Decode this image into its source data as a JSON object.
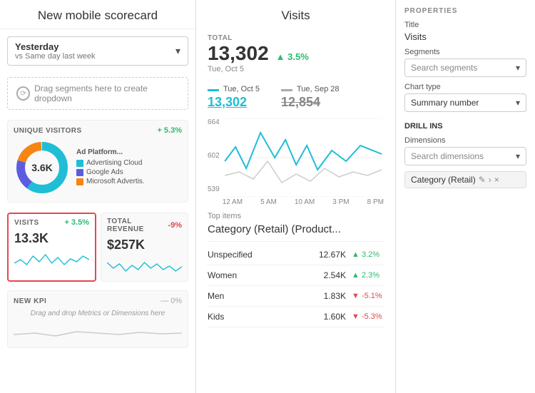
{
  "scorecard": {
    "title": "New mobile scorecard",
    "date_selector": {
      "main": "Yesterday",
      "sub": "vs Same day last week",
      "arrow": "▾"
    },
    "drag_segments": "Drag segments here to create dropdown",
    "unique_visitors": {
      "label": "UNIQUE VISITORS",
      "change": "+ 5.3%",
      "value": "3.6K",
      "legend_title": "Ad Platform...",
      "legend": [
        {
          "color": "#1fbed6",
          "label": "Advertising Cloud"
        },
        {
          "color": "#5c5ce0",
          "label": "Google Ads"
        },
        {
          "color": "#f68511",
          "label": "Microsoft Advertis."
        }
      ]
    },
    "visits_kpi": {
      "label": "VISITS",
      "change": "+ 3.5%",
      "value": "13.3K",
      "change_color": "pos"
    },
    "revenue_kpi": {
      "label": "TOTAL REVENUE",
      "change": "-9%",
      "value": "$257K",
      "change_color": "neg"
    },
    "new_kpi": {
      "label": "NEW KPI",
      "change": "— 0%",
      "desc": "Drag and drop Metrics or Dimensions here"
    }
  },
  "visits_panel": {
    "title": "Visits",
    "total_label": "TOTAL",
    "total_number": "13,302",
    "total_date": "Tue, Oct 5",
    "total_change": "▲ 3.5%",
    "comparison": [
      {
        "date": "Tue, Oct 5",
        "value": "13,302",
        "style": "teal"
      },
      {
        "date": "Tue, Sep 28",
        "value": "12,854",
        "style": "gray"
      }
    ],
    "chart_y_labels": [
      "664",
      "602",
      "539"
    ],
    "chart_x_labels": [
      "12 AM",
      "5 AM",
      "10 AM",
      "3 PM",
      "8 PM"
    ],
    "top_items_label": "Top items",
    "top_items_category": "Category (Retail) (Product...",
    "rows": [
      {
        "name": "Unspecified",
        "value": "12.67K",
        "change": "▲ 3.2%",
        "pos": true
      },
      {
        "name": "Women",
        "value": "2.54K",
        "change": "▲ 2.3%",
        "pos": true
      },
      {
        "name": "Men",
        "value": "1.83K",
        "change": "▼ -5.1%",
        "pos": false
      },
      {
        "name": "Kids",
        "value": "1.60K",
        "change": "▼ -5.3%",
        "pos": false
      }
    ]
  },
  "properties": {
    "section_title": "PROPERTIES",
    "title_label": "Title",
    "title_value": "Visits",
    "segments_label": "Segments",
    "segments_placeholder": "Search segments",
    "chart_type_label": "Chart type",
    "chart_type_value": "Summary number",
    "drill_ins_label": "DRILL INS",
    "dimensions_label": "Dimensions",
    "dimensions_placeholder": "Search dimensions",
    "dimension_tag": "Category (Retail)"
  }
}
